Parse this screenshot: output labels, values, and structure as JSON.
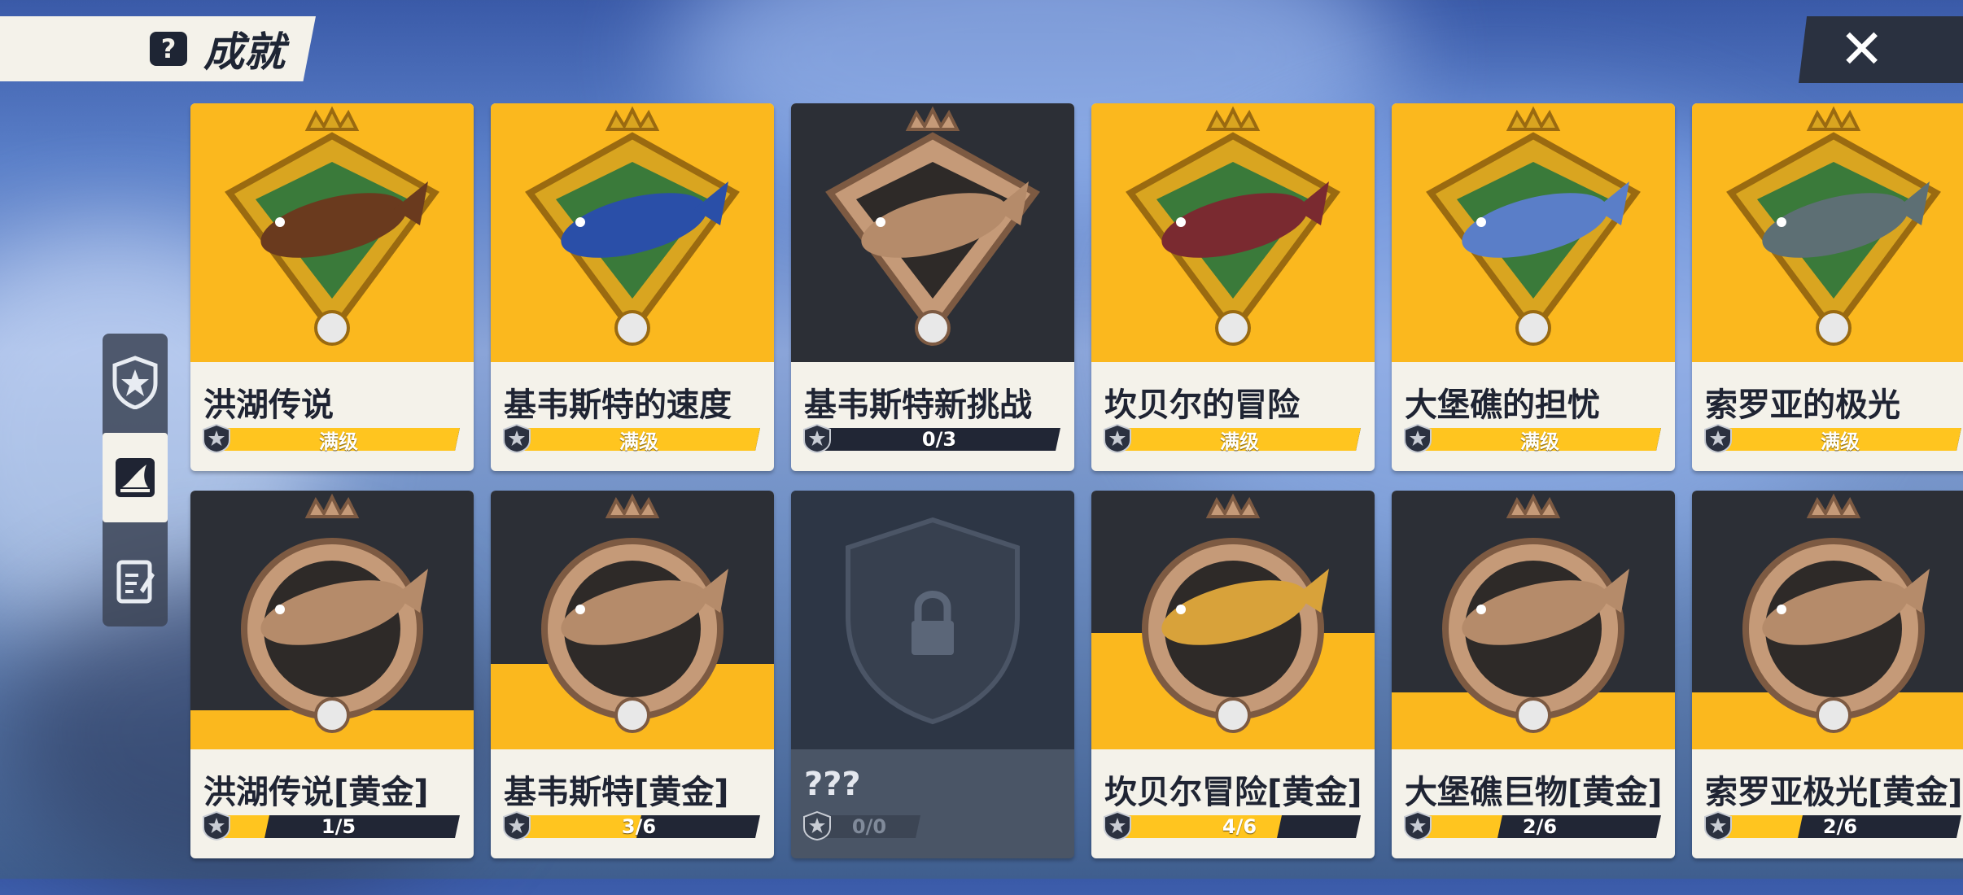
{
  "header": {
    "title": "成就",
    "help_icon": "question-icon",
    "close_icon": "close-icon"
  },
  "side_tabs": [
    {
      "icon": "star-shield-icon",
      "selected": false
    },
    {
      "icon": "shark-fin-icon",
      "selected": true
    },
    {
      "icon": "notebook-icon",
      "selected": false
    }
  ],
  "colors": {
    "accent_gold": "#fbb81e",
    "dark_panel": "#2c2f36",
    "card_cream": "#f4f2ea",
    "bar_dark": "#212635"
  },
  "achievements": [
    {
      "name": "洪湖传说",
      "progress_text": "满级",
      "progress": 1.0,
      "style": "gold",
      "fish_color": "#6a3a1e"
    },
    {
      "name": "基韦斯特的速度",
      "progress_text": "满级",
      "progress": 1.0,
      "style": "gold",
      "fish_color": "#2a4fa8"
    },
    {
      "name": "基韦斯特新挑战",
      "progress_text": "0/3",
      "progress": 0.0,
      "style": "dark",
      "fish_color": "#b58b6a"
    },
    {
      "name": "坎贝尔的冒险",
      "progress_text": "满级",
      "progress": 1.0,
      "style": "gold",
      "fish_color": "#7a2a30"
    },
    {
      "name": "大堡礁的担忧",
      "progress_text": "满级",
      "progress": 1.0,
      "style": "gold",
      "fish_color": "#5a7ec8"
    },
    {
      "name": "索罗亚的极光",
      "progress_text": "满级",
      "progress": 1.0,
      "style": "gold",
      "fish_color": "#5d6f74"
    },
    {
      "name": "洪湖传说[黄金]",
      "progress_text": "1/5",
      "progress": 0.2,
      "style": "half",
      "gold_level": 0.15,
      "fish_color": "#b58b6a"
    },
    {
      "name": "基韦斯特[黄金]",
      "progress_text": "3/6",
      "progress": 0.5,
      "style": "half",
      "gold_level": 0.33,
      "fish_color": "#b58b6a"
    },
    {
      "name": "???",
      "progress_text": "0/0",
      "progress": 0.0,
      "style": "locked",
      "fish_color": "#5a6678"
    },
    {
      "name": "坎贝尔冒险[黄金]",
      "progress_text": "4/6",
      "progress": 0.6667,
      "style": "half",
      "gold_level": 0.45,
      "fish_color": "#d8a23a"
    },
    {
      "name": "大堡礁巨物[黄金]",
      "progress_text": "2/6",
      "progress": 0.3333,
      "style": "half",
      "gold_level": 0.22,
      "fish_color": "#b58b6a"
    },
    {
      "name": "索罗亚极光[黄金]",
      "progress_text": "2/6",
      "progress": 0.3333,
      "style": "half",
      "gold_level": 0.22,
      "fish_color": "#b58b6a"
    }
  ]
}
